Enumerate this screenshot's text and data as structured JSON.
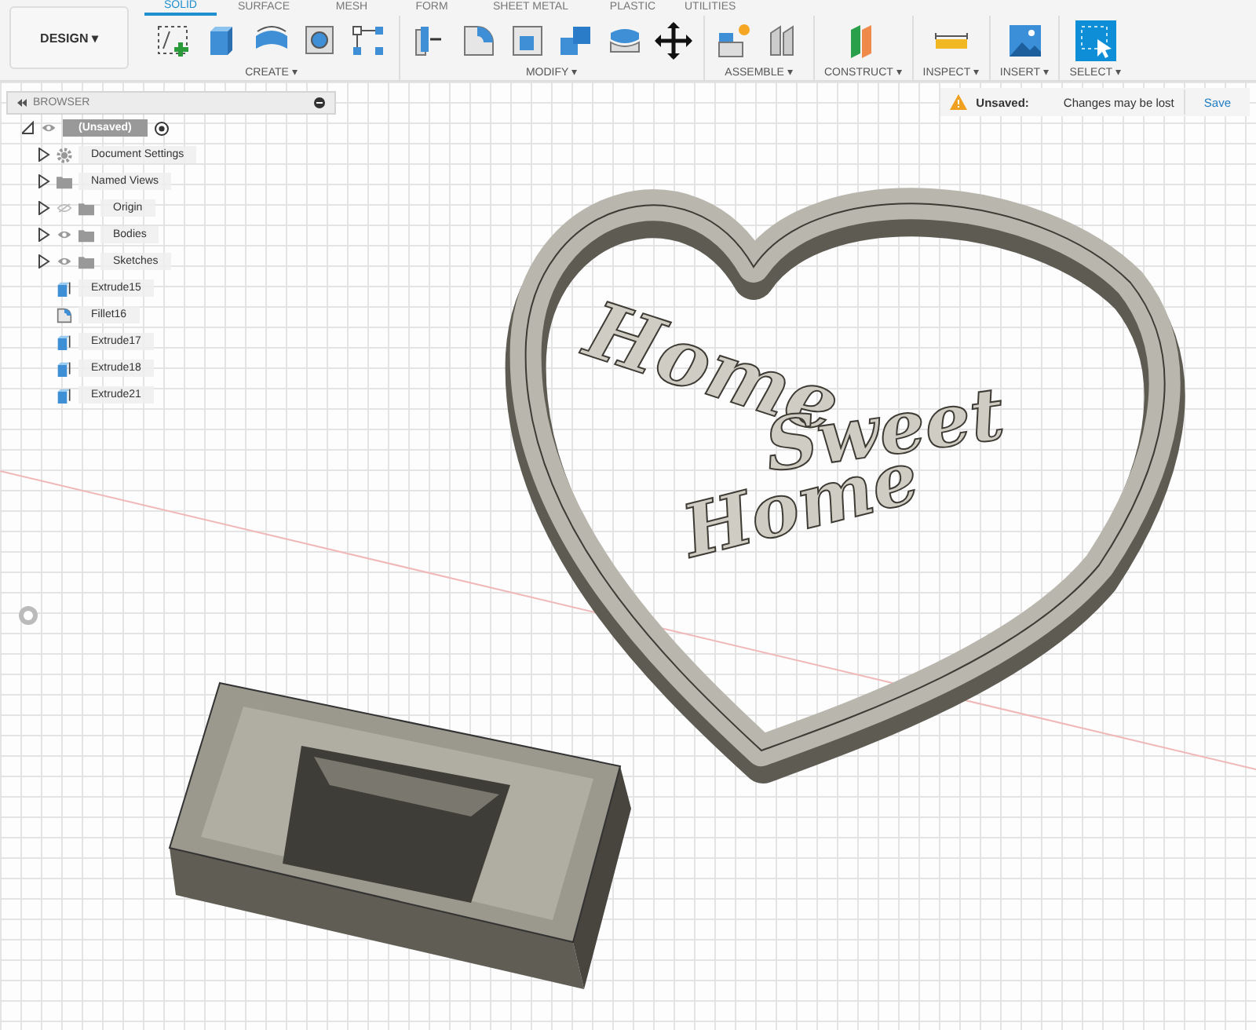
{
  "workspace_menu": {
    "label": "DESIGN",
    "caret": "▾"
  },
  "tabs": [
    {
      "label": "SOLID",
      "selected": true
    },
    {
      "label": "SURFACE",
      "selected": false
    },
    {
      "label": "MESH",
      "selected": false
    },
    {
      "label": "FORM",
      "selected": false
    },
    {
      "label": "SHEET METAL",
      "selected": false
    },
    {
      "label": "PLASTIC",
      "selected": false
    },
    {
      "label": "UTILITIES",
      "selected": false
    }
  ],
  "tool_groups": [
    {
      "label": "CREATE ▾"
    },
    {
      "label": "MODIFY ▾"
    },
    {
      "label": "ASSEMBLE ▾"
    },
    {
      "label": "CONSTRUCT ▾"
    },
    {
      "label": "INSPECT ▾"
    },
    {
      "label": "INSERT ▾"
    },
    {
      "label": "SELECT ▾"
    }
  ],
  "browser": {
    "title": "BROWSER",
    "root": {
      "label": "(Unsaved)",
      "selected": true,
      "expanded": true,
      "visible": true,
      "children": [
        {
          "label": "Document Settings",
          "selected": false,
          "kind": "settings",
          "expanded": false
        },
        {
          "label": "Named Views",
          "selected": false,
          "kind": "folder",
          "expanded": false
        },
        {
          "label": "Origin",
          "selected": false,
          "kind": "folder",
          "expanded": false,
          "visible": false
        },
        {
          "label": "Bodies",
          "selected": false,
          "kind": "folder",
          "expanded": false,
          "visible": true
        },
        {
          "label": "Sketches",
          "selected": false,
          "kind": "folder",
          "expanded": false,
          "visible": true
        },
        {
          "label": "Extrude15",
          "selected": false,
          "kind": "extrude"
        },
        {
          "label": "Fillet16",
          "selected": false,
          "kind": "fillet"
        },
        {
          "label": "Extrude17",
          "selected": false,
          "kind": "extrude"
        },
        {
          "label": "Extrude18",
          "selected": false,
          "kind": "extrude"
        },
        {
          "label": "Extrude21",
          "selected": false,
          "kind": "extrude"
        }
      ]
    }
  },
  "unsaved_bar": {
    "title": "Unsaved:",
    "message": "Changes may be lost",
    "action": "Save"
  },
  "model_text": [
    "Home",
    "Sweet",
    "Home"
  ]
}
